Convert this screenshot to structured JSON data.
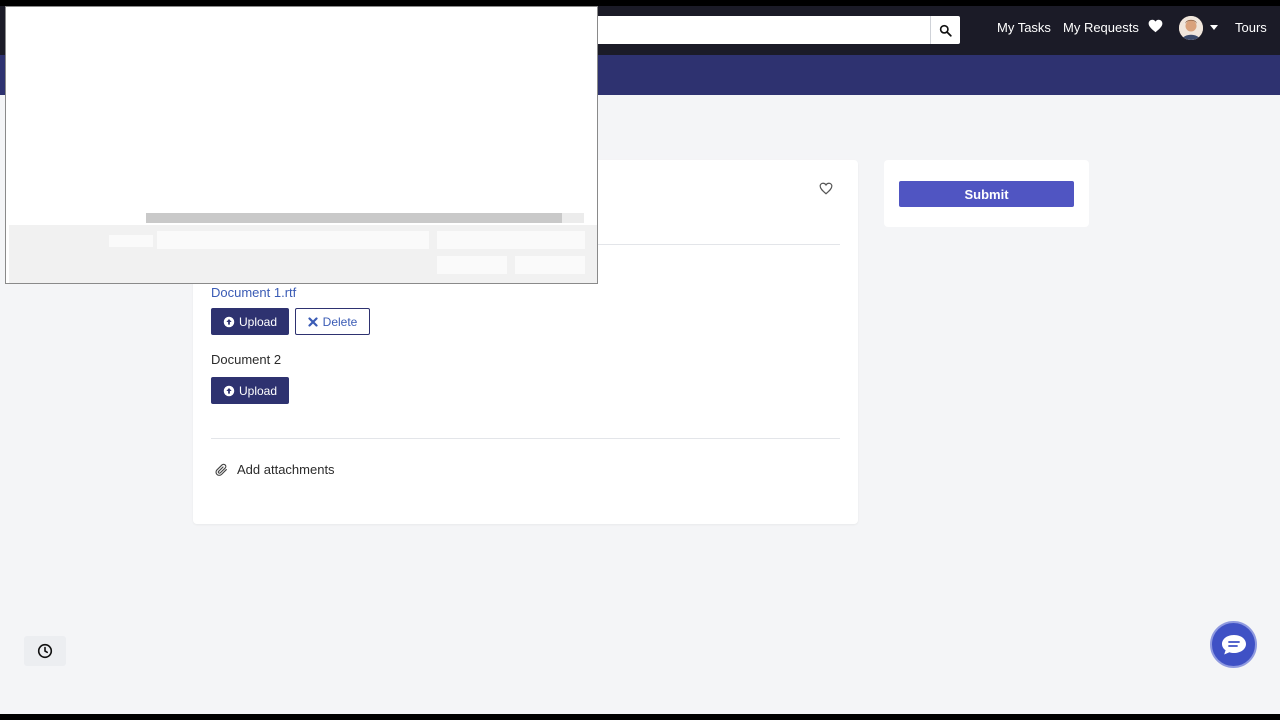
{
  "topnav": {
    "search": {
      "value": "",
      "placeholder": ""
    },
    "links": {
      "my_tasks": "My Tasks",
      "my_requests": "My Requests",
      "tours": "Tours"
    }
  },
  "card": {
    "documents": [
      {
        "name": "Document 1.rtf",
        "upload_label": "Upload",
        "delete_label": "Delete"
      },
      {
        "name": "Document 2",
        "upload_label": "Upload"
      }
    ],
    "add_attachments_label": "Add attachments"
  },
  "sidebar": {
    "submit_label": "Submit"
  },
  "colors": {
    "topnav_bg": "#1b1b27",
    "subbar_bg": "#2e3270",
    "primary_button": "#2e3270",
    "submit_button": "#5055c2",
    "link": "#3a5bb5",
    "chat_button": "#3f51c5"
  },
  "icons": {
    "search": "search-icon",
    "nav_heart": "heart-icon",
    "favorite": "heart-outline-icon",
    "upload": "upload-circle-icon",
    "delete": "close-icon",
    "attachment": "paperclip-icon",
    "history": "clock-icon",
    "chat": "chat-icon"
  }
}
